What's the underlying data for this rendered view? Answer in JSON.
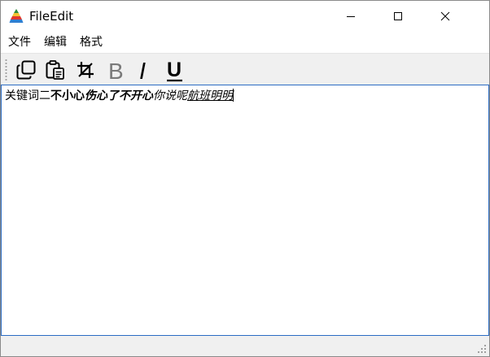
{
  "window": {
    "title": "FileEdit",
    "icons": {
      "app": "pyramid-app-icon",
      "minimize": "minimize-icon",
      "maximize": "maximize-icon",
      "close": "close-icon"
    }
  },
  "menu": {
    "items": [
      {
        "label": "文件"
      },
      {
        "label": "编辑"
      },
      {
        "label": "格式"
      }
    ]
  },
  "toolbar": {
    "bold_glyph": "B",
    "italic_glyph": "I",
    "underline_glyph": "U",
    "icons": [
      "copy-icon",
      "paste-icon",
      "crop-icon",
      "bold-icon",
      "italic-icon",
      "underline-icon"
    ]
  },
  "editor": {
    "segments": [
      {
        "text": "关键词二",
        "style": "plain"
      },
      {
        "text": "不小心",
        "style": "bold"
      },
      {
        "text": "伤心了不开心",
        "style": "bold-italic"
      },
      {
        "text": "你说呢",
        "style": "italic"
      },
      {
        "text": "航班明明",
        "style": "italic-underline"
      }
    ]
  },
  "colors": {
    "editor_border": "#2b6cc4",
    "toolbar_bg": "#f0f0f0",
    "bold_button_disabled": "#7a7a7a"
  }
}
